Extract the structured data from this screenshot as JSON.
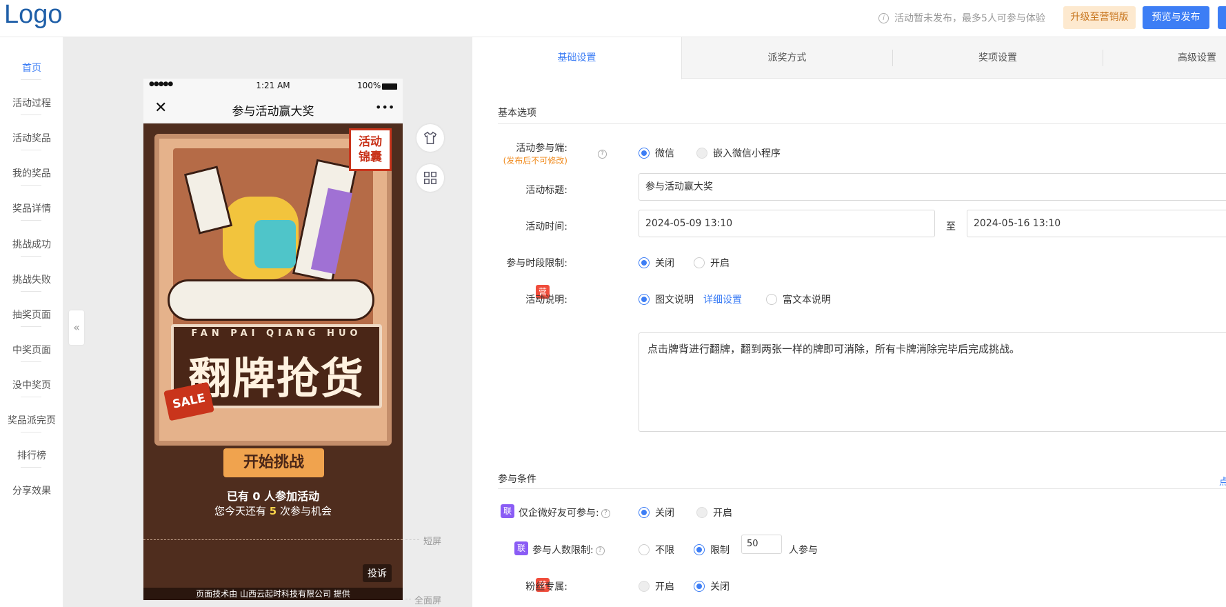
{
  "header": {
    "logo": "Logo",
    "notice": "活动暂未发布，最多5人可参与体验",
    "upgrade_label": "升级至营销版",
    "publish_label": "预览与发布"
  },
  "sidebar": {
    "items": [
      {
        "label": "首页",
        "active": true
      },
      {
        "label": "活动过程"
      },
      {
        "label": "活动奖品"
      },
      {
        "label": "我的奖品"
      },
      {
        "label": "奖品详情"
      },
      {
        "label": "挑战成功"
      },
      {
        "label": "挑战失败"
      },
      {
        "label": "抽奖页面"
      },
      {
        "label": "中奖页面"
      },
      {
        "label": "没中奖页"
      },
      {
        "label": "奖品派完页"
      },
      {
        "label": "排行榜"
      },
      {
        "label": "分享效果"
      }
    ],
    "collapse_glyph": "«"
  },
  "phone": {
    "status_dots": "●●●●●",
    "time": "1:21 AM",
    "battery": "100%",
    "close_glyph": "✕",
    "title": "参与活动赢大奖",
    "more_glyph": "•••",
    "poster": {
      "badge": "活动\n锦囊",
      "sub_title": "FAN PAI QIANG HUO",
      "main_title": "翻牌抢货",
      "sale": "SALE",
      "start_button": "开始挑战",
      "joined_text": "已有 0 人参加活动",
      "chances_prefix": "您今天还有 ",
      "chances_count": "5",
      "chances_suffix": " 次参与机会"
    },
    "complain": "投诉",
    "footer": "页面技术由 山西云起时科技有限公司 提供"
  },
  "canvas": {
    "short_screen": "短屏",
    "full_screen": "全面屏",
    "tools": [
      {
        "icon": "shirt-icon"
      },
      {
        "icon": "grid-icon"
      }
    ]
  },
  "tabs": [
    "基础设置",
    "派奖方式",
    "奖项设置",
    "高级设置"
  ],
  "basic": {
    "section_title": "基本选项",
    "participation_label": "活动参与端:",
    "participation_note": "(发布后不可修改)",
    "participation_options": [
      "微信",
      "嵌入微信小程序"
    ],
    "title_label": "活动标题:",
    "title_value": "参与活动赢大奖",
    "time_label": "活动时间:",
    "time_start": "2024-05-09 13:10",
    "time_to": "至",
    "time_end": "2024-05-16 13:10",
    "period_label": "参与时段限制:",
    "period_options": [
      "关闭",
      "开启"
    ],
    "desc_tag": "营",
    "desc_label": "活动说明:",
    "desc_options": [
      "图文说明",
      "富文本说明"
    ],
    "desc_link": "详细设置",
    "desc_text": "点击牌背进行翻牌，翻到两张一样的牌即可消除，所有卡牌消除完毕后完成挑战。"
  },
  "conditions": {
    "section_title": "参与条件",
    "right_link": "点",
    "friend_tag": "联",
    "friend_label": "仅企微好友可参与:",
    "friend_options": [
      "关闭",
      "开启"
    ],
    "limit_tag": "联",
    "limit_label": "参与人数限制:",
    "limit_options": [
      "不限",
      "限制"
    ],
    "limit_value": "50",
    "limit_suffix": "人参与",
    "fans_tag": "营",
    "fans_label": "粉丝专属:",
    "fans_options": [
      "开启",
      "关闭"
    ]
  }
}
